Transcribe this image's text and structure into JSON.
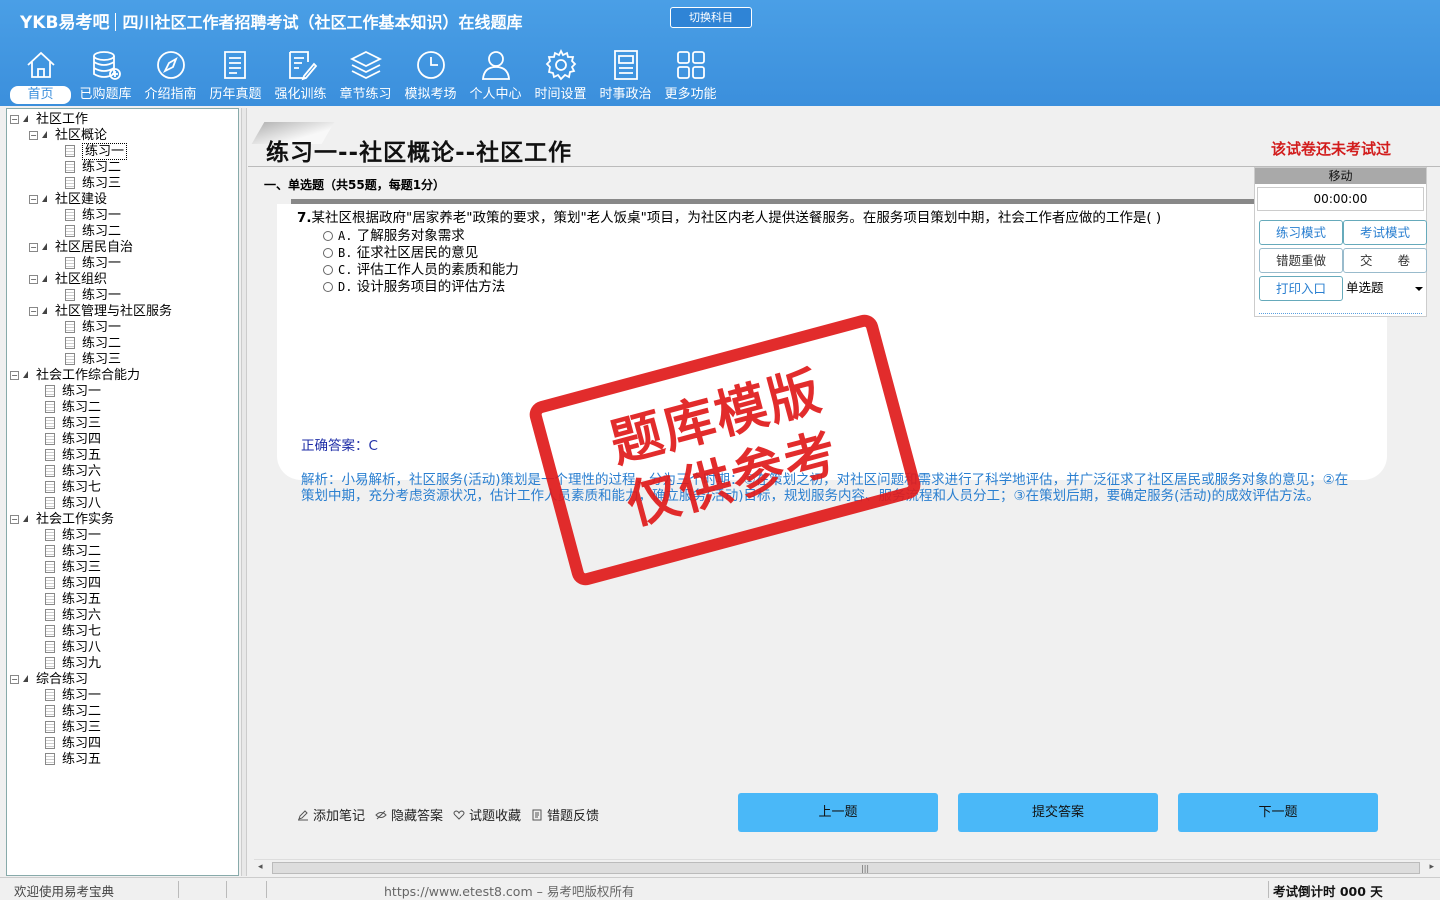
{
  "header": {
    "brand": "YKB易考吧",
    "title": "四川社区工作者招聘考试（社区工作基本知识）在线题库",
    "switch_label": "切换科目"
  },
  "nav": [
    {
      "label": "首页",
      "icon": "home-icon"
    },
    {
      "label": "已购题库",
      "icon": "database-icon"
    },
    {
      "label": "介绍指南",
      "icon": "compass-icon"
    },
    {
      "label": "历年真题",
      "icon": "list-doc-icon"
    },
    {
      "label": "强化训练",
      "icon": "edit-doc-icon"
    },
    {
      "label": "章节练习",
      "icon": "layers-icon"
    },
    {
      "label": "模拟考场",
      "icon": "clock-icon"
    },
    {
      "label": "个人中心",
      "icon": "user-icon"
    },
    {
      "label": "时间设置",
      "icon": "gear-icon"
    },
    {
      "label": "时事政治",
      "icon": "news-icon"
    },
    {
      "label": "更多功能",
      "icon": "grid-icon"
    }
  ],
  "tree": [
    {
      "label": "社区工作",
      "level": 0,
      "type": "root"
    },
    {
      "label": "社区概论",
      "level": 1,
      "type": "folder"
    },
    {
      "label": "练习一",
      "level": 2,
      "type": "doc",
      "selected": true
    },
    {
      "label": "练习二",
      "level": 2,
      "type": "doc"
    },
    {
      "label": "练习三",
      "level": 2,
      "type": "doc"
    },
    {
      "label": "社区建设",
      "level": 1,
      "type": "folder"
    },
    {
      "label": "练习一",
      "level": 2,
      "type": "doc"
    },
    {
      "label": "练习二",
      "level": 2,
      "type": "doc"
    },
    {
      "label": "社区居民自治",
      "level": 1,
      "type": "folder"
    },
    {
      "label": "练习一",
      "level": 2,
      "type": "doc"
    },
    {
      "label": "社区组织",
      "level": 1,
      "type": "folder"
    },
    {
      "label": "练习一",
      "level": 2,
      "type": "doc"
    },
    {
      "label": "社区管理与社区服务",
      "level": 1,
      "type": "folder"
    },
    {
      "label": "练习一",
      "level": 2,
      "type": "doc"
    },
    {
      "label": "练习二",
      "level": 2,
      "type": "doc"
    },
    {
      "label": "练习三",
      "level": 2,
      "type": "doc"
    },
    {
      "label": "社会工作综合能力",
      "level": 0,
      "type": "root2"
    },
    {
      "label": "练习一",
      "level": 1,
      "type": "doc"
    },
    {
      "label": "练习二",
      "level": 1,
      "type": "doc"
    },
    {
      "label": "练习三",
      "level": 1,
      "type": "doc"
    },
    {
      "label": "练习四",
      "level": 1,
      "type": "doc"
    },
    {
      "label": "练习五",
      "level": 1,
      "type": "doc"
    },
    {
      "label": "练习六",
      "level": 1,
      "type": "doc"
    },
    {
      "label": "练习七",
      "level": 1,
      "type": "doc"
    },
    {
      "label": "练习八",
      "level": 1,
      "type": "doc"
    },
    {
      "label": "社会工作实务",
      "level": 0,
      "type": "root2"
    },
    {
      "label": "练习一",
      "level": 1,
      "type": "doc"
    },
    {
      "label": "练习二",
      "level": 1,
      "type": "doc"
    },
    {
      "label": "练习三",
      "level": 1,
      "type": "doc"
    },
    {
      "label": "练习四",
      "level": 1,
      "type": "doc"
    },
    {
      "label": "练习五",
      "level": 1,
      "type": "doc"
    },
    {
      "label": "练习六",
      "level": 1,
      "type": "doc"
    },
    {
      "label": "练习七",
      "level": 1,
      "type": "doc"
    },
    {
      "label": "练习八",
      "level": 1,
      "type": "doc"
    },
    {
      "label": "练习九",
      "level": 1,
      "type": "doc"
    },
    {
      "label": "综合练习",
      "level": 0,
      "type": "root2"
    },
    {
      "label": "练习一",
      "level": 1,
      "type": "doc"
    },
    {
      "label": "练习二",
      "level": 1,
      "type": "doc"
    },
    {
      "label": "练习三",
      "level": 1,
      "type": "doc"
    },
    {
      "label": "练习四",
      "level": 1,
      "type": "doc"
    },
    {
      "label": "练习五",
      "level": 1,
      "type": "doc"
    }
  ],
  "main": {
    "page_title": "练习一--社区概论--社区工作",
    "status": "该试卷还未考试过",
    "section": "一、单选题（共55题，每题1分）",
    "question": {
      "number": "7.",
      "text": "某社区根据政府\"居家养老\"政策的要求，策划\"老人饭桌\"项目，为社区内老人提供送餐服务。在服务项目策划中期，社会工作者应做的工作是( )",
      "options": [
        {
          "key": "A.",
          "text": "了解服务对象需求"
        },
        {
          "key": "B.",
          "text": "征求社区居民的意见"
        },
        {
          "key": "C.",
          "text": "评估工作人员的素质和能力"
        },
        {
          "key": "D.",
          "text": "设计服务项目的评估方法"
        }
      ],
      "answer": "正确答案：C",
      "analysis": "解析：小易解析，社区服务(活动)策划是一个理性的过程，分为三个时期：①在策划之初，对社区问题和需求进行了科学地评估，并广泛征求了社区居民或服务对象的意见；②在策划中期，充分考虑资源状况，估计工作人员素质和能力，确立服务(活动)目标，规划服务内容、服务流程和人员分工；③在策划后期，要确定服务(活动)的成效评估方法。"
    },
    "stamp": {
      "line1": "题库模版",
      "line2": "仅供参考"
    }
  },
  "control": {
    "header": "移动",
    "timer": "00:00:00",
    "practice_mode": "练习模式",
    "exam_mode": "考试模式",
    "redo_wrong": "错题重做",
    "submit_paper": "交　　卷",
    "print": "打印入口",
    "type_select": "单选题"
  },
  "tools": {
    "note": "添加笔记",
    "hide_answer": "隐藏答案",
    "favorite": "试题收藏",
    "feedback": "错题反馈"
  },
  "buttons": {
    "prev": "上一题",
    "submit": "提交答案",
    "next": "下一题"
  },
  "statusbar": {
    "welcome": "欢迎使用易考宝典",
    "copyright": "https://www.etest8.com – 易考吧版权所有",
    "countdown": "考试倒计时 000 天"
  }
}
